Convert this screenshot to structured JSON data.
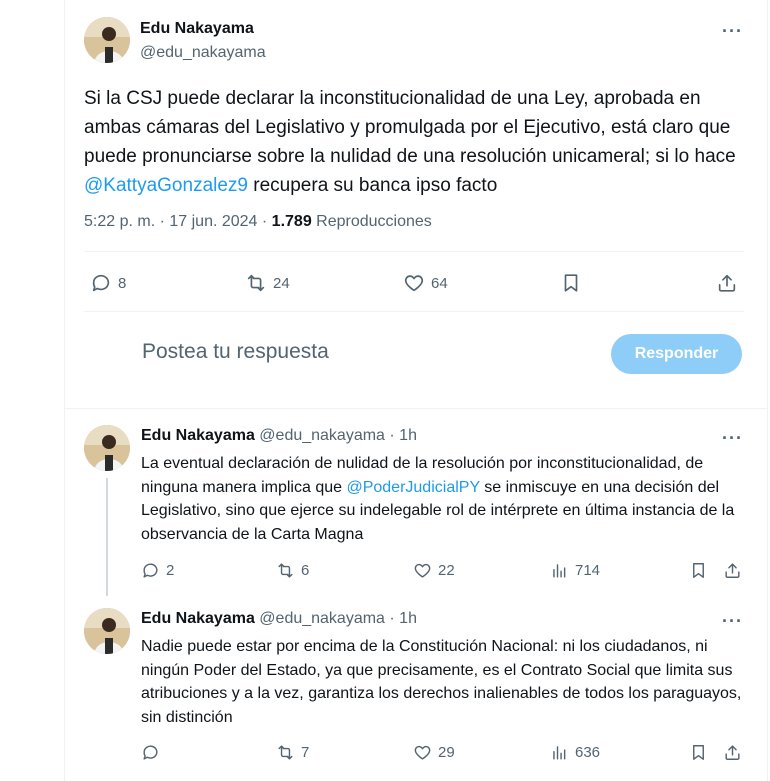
{
  "main_tweet": {
    "author_name": "Edu Nakayama",
    "author_handle": "@edu_nakayama",
    "text_before_mention": "Si la CSJ puede declarar la inconstitucionalidad de una Ley, aprobada en ambas cámaras del Legislativo y promulgada por el Ejecutivo, está claro que puede pronunciarse sobre la nulidad de una resolución unicameral; si lo hace ",
    "mention": "@KattyaGonzalez9",
    "text_after_mention": " recupera su banca ipso facto",
    "timestamp": "5:22 p. m. · 17 jun. 2024 · ",
    "views_count": "1.789",
    "views_label": " Reproducciones",
    "replies": "8",
    "retweets": "24",
    "likes": "64"
  },
  "composer": {
    "placeholder": "Postea tu respuesta",
    "button_label": "Responder"
  },
  "replies": [
    {
      "author_name": "Edu Nakayama",
      "author_handle": "@edu_nakayama",
      "time": "· 1h",
      "text_before_mention": "La eventual declaración de nulidad de la resolución por inconstitucionalidad, de ninguna manera implica que ",
      "mention": "@PoderJudicialPY",
      "text_after_mention": " se inmiscuye en una decisión del Legislativo, sino que ejerce su indelegable rol de intérprete en última instancia de la observancia de la Carta Magna",
      "replies": "2",
      "retweets": "6",
      "likes": "22",
      "views": "714"
    },
    {
      "author_name": "Edu Nakayama",
      "author_handle": "@edu_nakayama",
      "time": "· 1h",
      "text": "Nadie puede estar por encima de la Constitución Nacional: ni los ciudadanos, ni ningún Poder del Estado, ya que precisamente, es el Contrato Social que limita sus atribuciones y a la vez, garantiza los derechos inalienables de todos los paraguayos, sin distinción",
      "replies": "",
      "retweets": "7",
      "likes": "29",
      "views": "636"
    }
  ],
  "icons": {
    "reply": "speech-bubble-icon",
    "retweet": "retweet-arrows-icon",
    "like": "heart-icon",
    "views": "bar-chart-icon",
    "bookmark": "bookmark-icon",
    "share": "share-upload-icon",
    "more": "more-dots-icon"
  },
  "colors": {
    "link": "#1d9bf0",
    "button": "#8ecdf8",
    "muted": "#536471",
    "text": "#0f1419"
  }
}
